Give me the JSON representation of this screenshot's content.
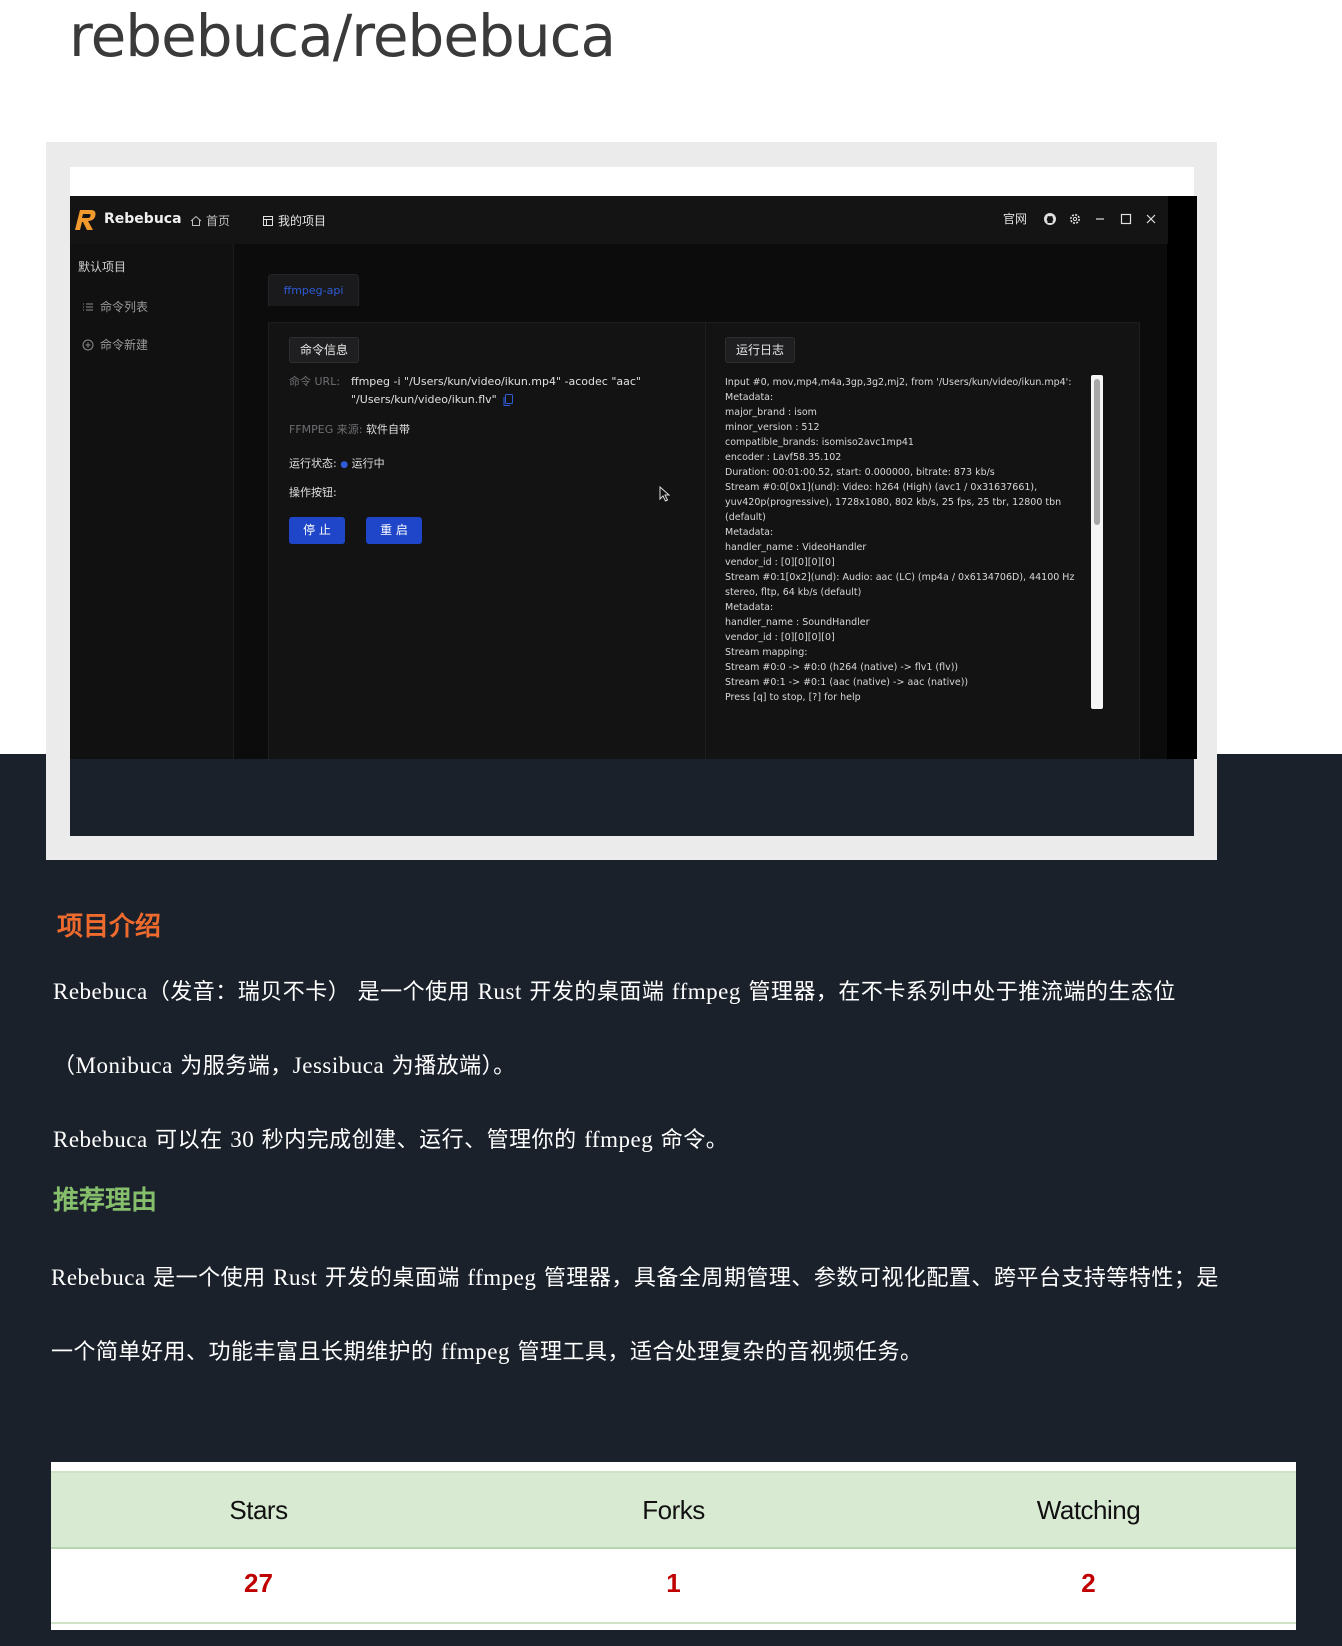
{
  "page": {
    "repo_title": "rebebuca/rebebuca"
  },
  "app": {
    "brand": "Rebebuca",
    "nav": [
      {
        "label": "首页"
      },
      {
        "label": "我的项目"
      }
    ],
    "header_right": {
      "official_site": "官网"
    },
    "sidebar": {
      "title": "默认项目",
      "items": [
        {
          "label": "命令列表"
        },
        {
          "label": "命令新建"
        }
      ]
    },
    "tab_label": "ffmpeg-api",
    "command_info": {
      "badge": "命令信息",
      "url_key": "命令 URL:",
      "url_line1": "ffmpeg  -i \"/Users/kun/video/ikun.mp4\" -acodec \"aac\"",
      "url_line2": "\"/Users/kun/video/ikun.flv\"",
      "source_key": "FFMPEG 来源:",
      "source_val": "软件自带",
      "status_key": "运行状态:",
      "status_val": "运行中",
      "ops_key": "操作按钮:",
      "stop_label": "停 止",
      "restart_label": "重 启"
    },
    "log": {
      "badge": "运行日志",
      "lines": [
        "Input #0, mov,mp4,m4a,3gp,3g2,mj2, from '/Users/kun/video/ikun.mp4':",
        "Metadata:",
        "major_brand : isom",
        "minor_version : 512",
        "compatible_brands: isomiso2avc1mp41",
        "encoder : Lavf58.35.102",
        "Duration: 00:01:00.52, start: 0.000000, bitrate: 873 kb/s",
        "Stream #0:0[0x1](und): Video: h264 (High) (avc1 / 0x31637661),",
        "yuv420p(progressive), 1728x1080, 802 kb/s, 25 fps, 25 tbr, 12800 tbn",
        "(default)",
        "Metadata:",
        "handler_name : VideoHandler",
        "vendor_id : [0][0][0][0]",
        "Stream #0:1[0x2](und): Audio: aac (LC) (mp4a / 0x6134706D), 44100 Hz,",
        "stereo, fltp, 64 kb/s (default)",
        "Metadata:",
        "handler_name : SoundHandler",
        "vendor_id : [0][0][0][0]",
        "Stream mapping:",
        "Stream #0:0 -> #0:0 (h264 (native) -> flv1 (flv))",
        "Stream #0:1 -> #0:1 (aac (native) -> aac (native))",
        "Press [q] to stop, [?] for help"
      ]
    }
  },
  "article": {
    "intro_heading": "项目介绍",
    "intro_p1_l1": [
      {
        "t": "Rebebuca",
        "lat": true
      },
      {
        "t": "（发音：瑞贝不卡） 是一个使用 ",
        "lat": false
      },
      {
        "t": "Rust",
        "lat": true
      },
      {
        "t": " 开发的桌面端 ",
        "lat": false
      },
      {
        "t": "ffmpeg",
        "lat": true
      },
      {
        "t": " 管理器，在不卡系列中处于推流端的生态位",
        "lat": false
      }
    ],
    "intro_p1_l2": [
      {
        "t": "（",
        "lat": false
      },
      {
        "t": "Monibuca",
        "lat": true
      },
      {
        "t": " 为服务端，",
        "lat": false
      },
      {
        "t": "Jessibuca",
        "lat": true
      },
      {
        "t": " 为播放端）。",
        "lat": false
      }
    ],
    "intro_p2": [
      {
        "t": "Rebebuca",
        "lat": true
      },
      {
        "t": " 可以在 ",
        "lat": false
      },
      {
        "t": "30",
        "lat": true
      },
      {
        "t": " 秒内完成创建、运行、管理你的 ",
        "lat": false
      },
      {
        "t": "ffmpeg",
        "lat": true
      },
      {
        "t": " 命令。",
        "lat": false
      }
    ],
    "reason_heading": "推荐理由",
    "reason_l1": [
      {
        "t": "Rebebuca",
        "lat": true
      },
      {
        "t": " 是一个使用 ",
        "lat": false
      },
      {
        "t": "Rust",
        "lat": true
      },
      {
        "t": " 开发的桌面端 ",
        "lat": false
      },
      {
        "t": "ffmpeg",
        "lat": true
      },
      {
        "t": " 管理器，具备全周期管理、参数可视化配置、跨平台支持等特性；是",
        "lat": false
      }
    ],
    "reason_l2": [
      {
        "t": "一个简单好用、功能丰富且长期维护的 ",
        "lat": false
      },
      {
        "t": "ffmpeg",
        "lat": true
      },
      {
        "t": " 管理工具，适合处理复杂的音视频任务。",
        "lat": false
      }
    ]
  },
  "stats": {
    "headers": [
      "Stars",
      "Forks",
      "Watching"
    ],
    "values": [
      "27",
      "1",
      "2"
    ]
  },
  "colors": {
    "accent_orange": "#ee6a2d",
    "accent_green": "#86bf6b",
    "stat_red": "#c00000",
    "button_blue": "#1f46c9",
    "dark_bg": "#1b212b"
  }
}
